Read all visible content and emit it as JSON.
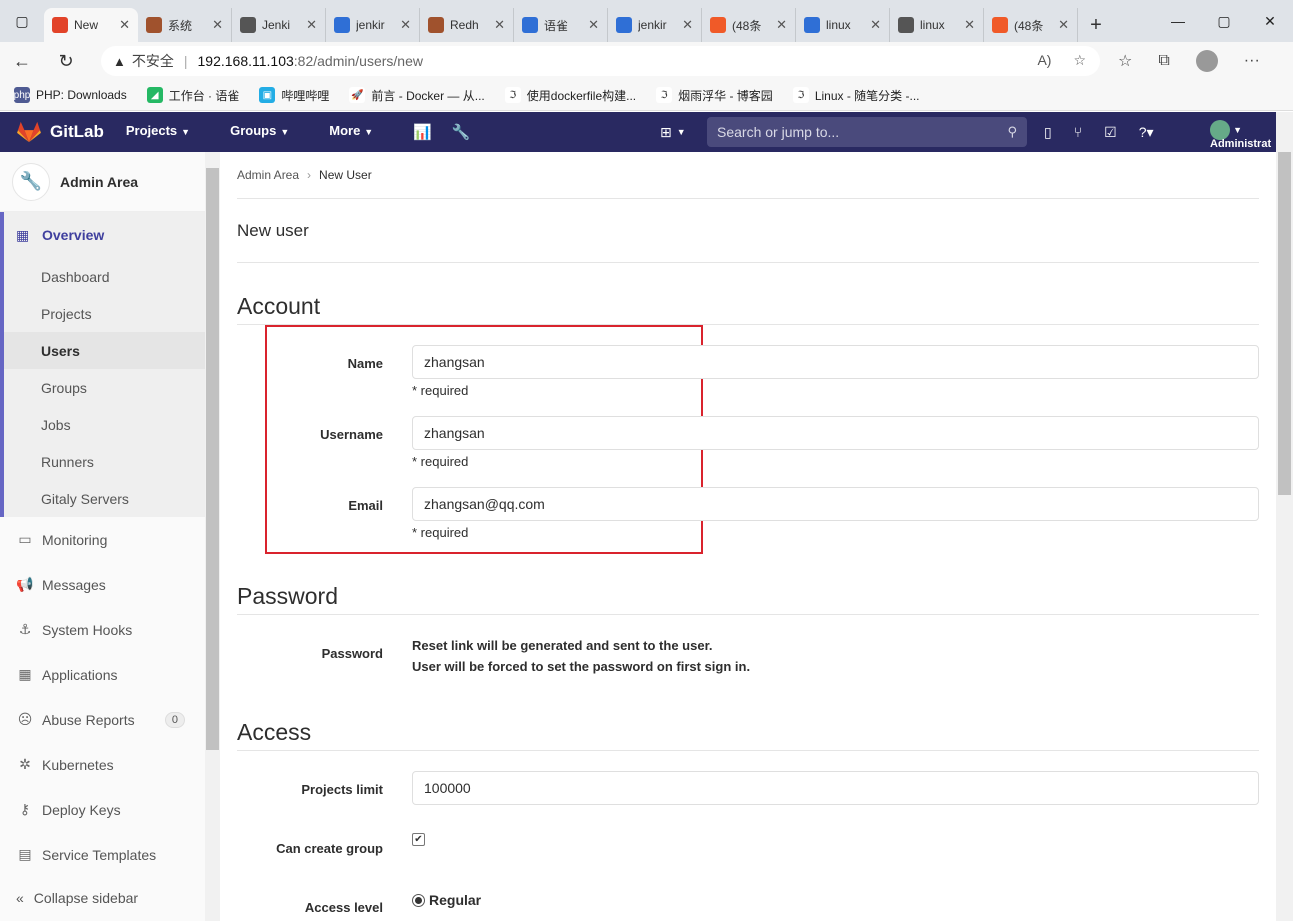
{
  "browser": {
    "tabs": [
      {
        "title": "New",
        "color": "#e24329",
        "active": true
      },
      {
        "title": "系统",
        "color": "#a0522d"
      },
      {
        "title": "Jenki",
        "color": "#555555"
      },
      {
        "title": "jenkir",
        "color": "#2f6fd6"
      },
      {
        "title": "Redh",
        "color": "#a0522d"
      },
      {
        "title": "语雀",
        "color": "#2f6fd6"
      },
      {
        "title": "jenkir",
        "color": "#2f6fd6"
      },
      {
        "title": "(48条",
        "color": "#f05a28"
      },
      {
        "title": "linux",
        "color": "#2f6fd6"
      },
      {
        "title": "linux",
        "color": "#555555"
      },
      {
        "title": "(48条",
        "color": "#f05a28"
      }
    ],
    "insecure_label": "不安全",
    "url_host": "192.168.11.103",
    "url_path": ":82/admin/users/new",
    "bookmarks": [
      {
        "label": "PHP: Downloads",
        "icon": "php-icon",
        "glyph": "php",
        "color": "#4f5b93"
      },
      {
        "label": "工作台 · 语雀",
        "icon": "yuque-icon",
        "glyph": "◢",
        "color": "#25b864"
      },
      {
        "label": "哔哩哔哩",
        "icon": "bilibili-icon",
        "glyph": "▣",
        "color": "#23ade5"
      },
      {
        "label": "前言 - Docker — 从...",
        "icon": "rocket-icon",
        "glyph": "🚀",
        "color": "#ffffff"
      },
      {
        "label": "使用dockerfile构建...",
        "icon": "cnblogs-icon",
        "glyph": "ℑ",
        "color": "#ffffff"
      },
      {
        "label": "烟雨浮华 - 博客园",
        "icon": "cnblogs-icon",
        "glyph": "ℑ",
        "color": "#ffffff"
      },
      {
        "label": "Linux - 随笔分类 -...",
        "icon": "cnblogs-icon",
        "glyph": "ℑ",
        "color": "#ffffff"
      }
    ]
  },
  "gitlab": {
    "brand": "GitLab",
    "menu": [
      "Projects",
      "Groups",
      "More"
    ],
    "search_placeholder": "Search or jump to...",
    "admin_label": "Administrat"
  },
  "sidebar": {
    "context": "Admin Area",
    "overview": "Overview",
    "overview_items": [
      "Dashboard",
      "Projects",
      "Users",
      "Groups",
      "Jobs",
      "Runners",
      "Gitaly Servers"
    ],
    "active_item": "Users",
    "items": [
      {
        "label": "Monitoring",
        "icon": "monitor-icon",
        "glyph": "▭"
      },
      {
        "label": "Messages",
        "icon": "megaphone-icon",
        "glyph": "📢"
      },
      {
        "label": "System Hooks",
        "icon": "hook-icon",
        "glyph": "⚓"
      },
      {
        "label": "Applications",
        "icon": "apps-icon",
        "glyph": "▦"
      },
      {
        "label": "Abuse Reports",
        "icon": "abuse-icon",
        "glyph": "☹",
        "badge": "0"
      },
      {
        "label": "Kubernetes",
        "icon": "kubernetes-icon",
        "glyph": "✲"
      },
      {
        "label": "Deploy Keys",
        "icon": "key-icon",
        "glyph": "⚷"
      },
      {
        "label": "Service Templates",
        "icon": "template-icon",
        "glyph": "▤"
      }
    ],
    "collapse": "Collapse sidebar"
  },
  "content": {
    "breadcrumb_parent": "Admin Area",
    "breadcrumb_current": "New User",
    "page_title": "New user",
    "account": {
      "title": "Account",
      "name_label": "Name",
      "name_value": "zhangsan",
      "username_label": "Username",
      "username_value": "zhangsan",
      "email_label": "Email",
      "email_value": "zhangsan@qq.com",
      "required": "* required"
    },
    "password": {
      "title": "Password",
      "label": "Password",
      "line1": "Reset link will be generated and sent to the user.",
      "line2": "User will be forced to set the password on first sign in."
    },
    "access": {
      "title": "Access",
      "projects_limit_label": "Projects limit",
      "projects_limit_value": "100000",
      "can_create_group_label": "Can create group",
      "can_create_group_checked": true,
      "access_level_label": "Access level",
      "access_level_value": "Regular"
    }
  }
}
